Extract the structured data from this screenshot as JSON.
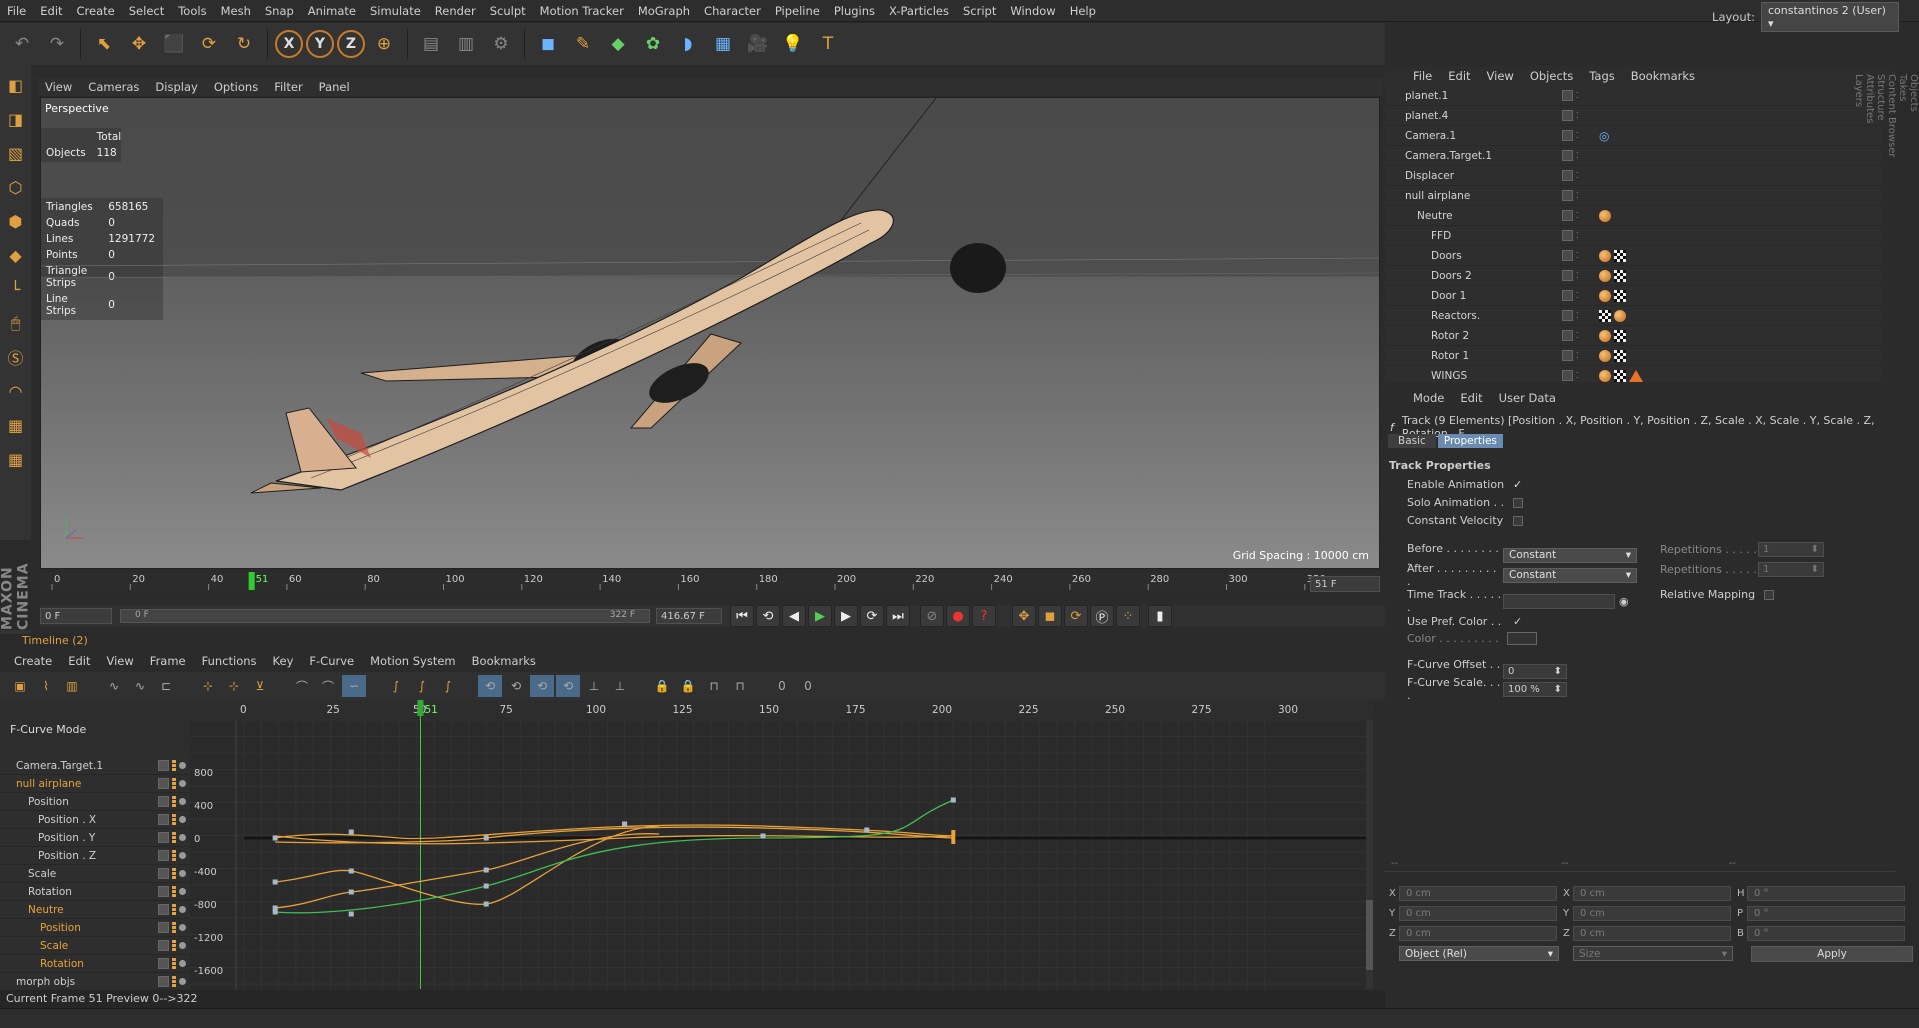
{
  "menubar": {
    "items": [
      "File",
      "Edit",
      "Create",
      "Select",
      "Tools",
      "Mesh",
      "Snap",
      "Animate",
      "Simulate",
      "Render",
      "Sculpt",
      "Motion Tracker",
      "MoGraph",
      "Character",
      "Pipeline",
      "Plugins",
      "X-Particles",
      "Script",
      "Window",
      "Help"
    ]
  },
  "layout": {
    "label": "Layout:",
    "value": "constantinos 2 (User)"
  },
  "top_toolbar": {
    "xyz": [
      "X",
      "Y",
      "Z"
    ]
  },
  "viewport": {
    "menu": [
      "View",
      "Cameras",
      "Display",
      "Options",
      "Filter",
      "Panel"
    ],
    "label": "Perspective",
    "total_header": "Total",
    "objects": {
      "label": "Objects",
      "value": "118"
    },
    "stats": [
      {
        "label": "Triangles",
        "value": "658165"
      },
      {
        "label": "Quads",
        "value": "0"
      },
      {
        "label": "Lines",
        "value": "1291772"
      },
      {
        "label": "Points",
        "value": "0"
      },
      {
        "label": "Triangle Strips",
        "value": "0"
      },
      {
        "label": "Line Strips",
        "value": "0"
      }
    ],
    "grid_spacing": "Grid Spacing : 10000 cm"
  },
  "timeline_ruler": {
    "ticks": [
      "0",
      "20",
      "40",
      "60",
      "80",
      "100",
      "120",
      "140",
      "160",
      "180",
      "200",
      "220",
      "240",
      "260",
      "280",
      "300",
      "320"
    ],
    "current": "51",
    "end_field": "51 F"
  },
  "anim": {
    "start": "0 F",
    "range_start": "0 F",
    "range_end": "322 F",
    "end": "416.67 F"
  },
  "timeline": {
    "title": "Timeline (2)",
    "menu": [
      "Create",
      "Edit",
      "View",
      "Frame",
      "Functions",
      "Key",
      "F-Curve",
      "Motion System",
      "Bookmarks"
    ],
    "mode": "F-Curve Mode",
    "ruler": [
      "0",
      "25",
      "50",
      "75",
      "100",
      "125",
      "150",
      "175",
      "200",
      "225",
      "250",
      "275",
      "300"
    ],
    "current": "51",
    "yaxis": [
      "800",
      "400",
      "0",
      "-400",
      "-800",
      "-1200",
      "-1600"
    ],
    "tree": [
      {
        "label": "Camera.Target.1",
        "orange": false
      },
      {
        "label": "null airplane",
        "orange": true
      },
      {
        "label": "Position",
        "orange": false
      },
      {
        "label": "Position . X",
        "orange": false
      },
      {
        "label": "Position . Y",
        "orange": false
      },
      {
        "label": "Position . Z",
        "orange": false
      },
      {
        "label": "Scale",
        "orange": false
      },
      {
        "label": "Rotation",
        "orange": false
      },
      {
        "label": "Neutre",
        "orange": true
      },
      {
        "label": "Position",
        "orange": true
      },
      {
        "label": "Scale",
        "orange": true
      },
      {
        "label": "Rotation",
        "orange": true
      },
      {
        "label": "morph objs",
        "orange": false
      }
    ]
  },
  "status": "Current Frame  51  Preview  0-->322",
  "object_manager": {
    "menu": [
      "File",
      "Edit",
      "View",
      "Objects",
      "Tags",
      "Bookmarks"
    ],
    "rows": [
      {
        "name": "planet.1",
        "tags": ""
      },
      {
        "name": "planet.4",
        "tags": ""
      },
      {
        "name": "Camera.1",
        "tags": "target"
      },
      {
        "name": "Camera.Target.1",
        "tags": ""
      },
      {
        "name": "Displacer",
        "tags": ""
      },
      {
        "name": "null airplane",
        "tags": ""
      },
      {
        "name": "Neutre",
        "tags": "phong"
      },
      {
        "name": "FFD",
        "tags": ""
      },
      {
        "name": "Doors",
        "tags": "pc"
      },
      {
        "name": "Doors 2",
        "tags": "pc"
      },
      {
        "name": "Door 1",
        "tags": "pc"
      },
      {
        "name": "Reactors.",
        "tags": "cp"
      },
      {
        "name": "Rotor 2",
        "tags": "pc"
      },
      {
        "name": "Rotor 1",
        "tags": "pc"
      },
      {
        "name": "WINGS",
        "tags": "pct"
      }
    ]
  },
  "attributes": {
    "menu": [
      "Mode",
      "Edit",
      "User Data"
    ],
    "track_title": "Track (9 Elements) [Position . X, Position . Y, Position . Z, Scale . X, Scale . Y, Scale . Z, Rotation . F",
    "tabs": [
      "Basic",
      "Properties"
    ],
    "section": "Track Properties",
    "enable_animation": "Enable Animation",
    "solo_animation": "Solo Animation . .",
    "constant_velocity": "Constant Velocity",
    "before_label": "Before . . . . . . . . .",
    "before_value": "Constant",
    "after_label": "After . . . . . . . . . .",
    "after_value": "Constant",
    "repetitions_label": "Repetitions . . . . .",
    "repetitions_value": "1",
    "time_track": "Time Track . . . . . .",
    "relative_mapping": "Relative Mapping",
    "use_pref_color": "Use Pref. Color . .",
    "color_label": "Color . . . . . . . . .",
    "fcurve_offset_label": "F-Curve Offset . . .",
    "fcurve_offset_value": "0",
    "fcurve_scale_label": "F-Curve Scale. . . .",
    "fcurve_scale_value": "100 %"
  },
  "coordinates": {
    "pos_labels": [
      "X",
      "Y",
      "Z"
    ],
    "size_labels": [
      "X",
      "Y",
      "Z"
    ],
    "rot_labels": [
      "H",
      "P",
      "B"
    ],
    "pos_values": [
      "0 cm",
      "0 cm",
      "0 cm"
    ],
    "size_values": [
      "0 cm",
      "0 cm",
      "0 cm"
    ],
    "rot_values": [
      "0 °",
      "0 °",
      "0 °"
    ],
    "mode": "Object (Rel)",
    "size_mode": "Size",
    "apply": "Apply"
  },
  "side_tabs": [
    "Objects",
    "Takes",
    "Content Browser",
    "Structure",
    "Attributes",
    "Layers"
  ]
}
